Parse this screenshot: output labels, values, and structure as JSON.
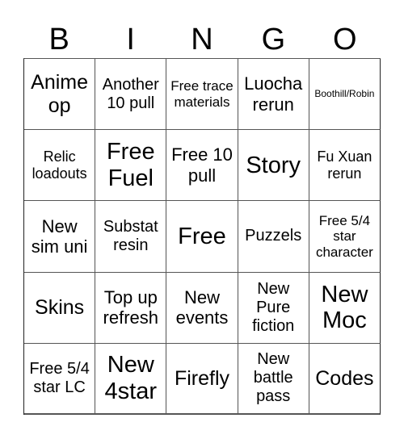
{
  "title_letters": [
    "B",
    "I",
    "N",
    "G",
    "O"
  ],
  "cells": [
    [
      "Anime op",
      "Another 10 pull",
      "Free trace materials",
      "Luocha rerun",
      "Boothill/Robin"
    ],
    [
      "Relic loadouts",
      "Free Fuel",
      "Free 10 pull",
      "Story",
      "Fu Xuan rerun"
    ],
    [
      "New sim uni",
      "Substat resin",
      "Free",
      "Puzzels",
      "Free 5/4 star character"
    ],
    [
      "Skins",
      "Top up refresh",
      "New events",
      "New Pure fiction",
      "New Moc"
    ],
    [
      "Free 5/4 star LC",
      "New 4star",
      "Firefly",
      "New battle pass",
      "Codes"
    ]
  ]
}
